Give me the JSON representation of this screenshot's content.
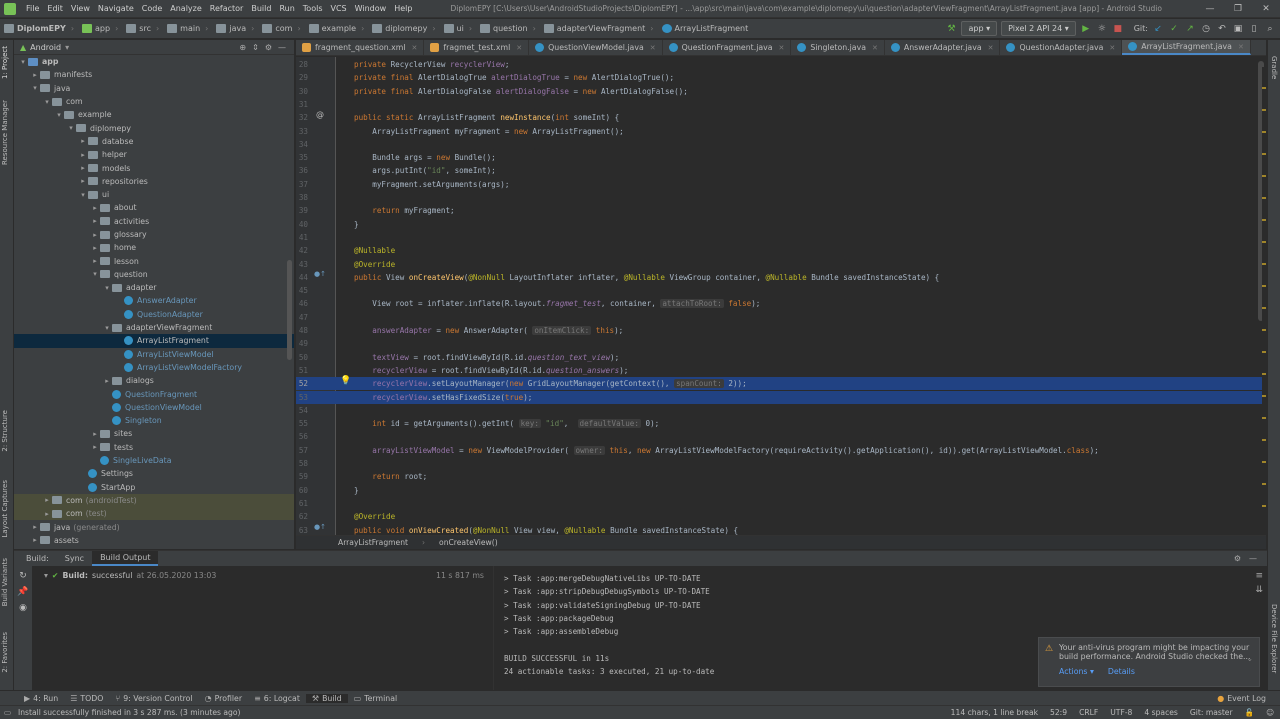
{
  "menu": {
    "items": [
      "File",
      "Edit",
      "View",
      "Navigate",
      "Code",
      "Analyze",
      "Refactor",
      "Build",
      "Run",
      "Tools",
      "VCS",
      "Window",
      "Help"
    ],
    "title": "DiplomEPY [C:\\Users\\User\\AndroidStudioProjects\\DiplomEPY] - ...\\app\\src\\main\\java\\com\\example\\diplomepy\\ui\\question\\adapterViewFragment\\ArrayListFragment.java [app] - Android Studio"
  },
  "breadcrumbs": [
    "DiplomEPY",
    "app",
    "src",
    "main",
    "java",
    "com",
    "example",
    "diplomepy",
    "ui",
    "question",
    "adapterViewFragment",
    "ArrayListFragment"
  ],
  "run_config": {
    "module": "app",
    "device": "Pixel 2 API 24",
    "git_label": "Git:"
  },
  "project": {
    "view": "Android",
    "tree": [
      {
        "label": "app",
        "depth": 0,
        "arrow": "▾",
        "kind": "folder-blue"
      },
      {
        "label": "manifests",
        "depth": 1,
        "arrow": "▸",
        "kind": "folder"
      },
      {
        "label": "java",
        "depth": 1,
        "arrow": "▾",
        "kind": "folder"
      },
      {
        "label": "com",
        "depth": 2,
        "arrow": "▾",
        "kind": "folder"
      },
      {
        "label": "example",
        "depth": 3,
        "arrow": "▾",
        "kind": "folder"
      },
      {
        "label": "diplomepy",
        "depth": 4,
        "arrow": "▾",
        "kind": "folder"
      },
      {
        "label": "databse",
        "depth": 5,
        "arrow": "▸",
        "kind": "folder"
      },
      {
        "label": "helper",
        "depth": 5,
        "arrow": "▸",
        "kind": "folder"
      },
      {
        "label": "models",
        "depth": 5,
        "arrow": "▸",
        "kind": "folder"
      },
      {
        "label": "repositories",
        "depth": 5,
        "arrow": "▸",
        "kind": "folder"
      },
      {
        "label": "ui",
        "depth": 5,
        "arrow": "▾",
        "kind": "folder"
      },
      {
        "label": "about",
        "depth": 6,
        "arrow": "▸",
        "kind": "folder"
      },
      {
        "label": "activities",
        "depth": 6,
        "arrow": "▸",
        "kind": "folder"
      },
      {
        "label": "glossary",
        "depth": 6,
        "arrow": "▸",
        "kind": "folder"
      },
      {
        "label": "home",
        "depth": 6,
        "arrow": "▸",
        "kind": "folder"
      },
      {
        "label": "lesson",
        "depth": 6,
        "arrow": "▸",
        "kind": "folder"
      },
      {
        "label": "question",
        "depth": 6,
        "arrow": "▾",
        "kind": "folder"
      },
      {
        "label": "adapter",
        "depth": 7,
        "arrow": "▾",
        "kind": "folder"
      },
      {
        "label": "AnswerAdapter",
        "depth": 8,
        "arrow": "",
        "kind": "class"
      },
      {
        "label": "QuestionAdapter",
        "depth": 8,
        "arrow": "",
        "kind": "class"
      },
      {
        "label": "adapterViewFragment",
        "depth": 7,
        "arrow": "▾",
        "kind": "folder"
      },
      {
        "label": "ArrayListFragment",
        "depth": 8,
        "arrow": "",
        "kind": "class",
        "selected": true
      },
      {
        "label": "ArrayListViewModel",
        "depth": 8,
        "arrow": "",
        "kind": "class"
      },
      {
        "label": "ArrayListViewModelFactory",
        "depth": 8,
        "arrow": "",
        "kind": "class"
      },
      {
        "label": "dialogs",
        "depth": 7,
        "arrow": "▸",
        "kind": "folder"
      },
      {
        "label": "QuestionFragment",
        "depth": 7,
        "arrow": "",
        "kind": "class"
      },
      {
        "label": "QuestionViewModel",
        "depth": 7,
        "arrow": "",
        "kind": "class"
      },
      {
        "label": "Singleton",
        "depth": 7,
        "arrow": "",
        "kind": "class"
      },
      {
        "label": "sites",
        "depth": 6,
        "arrow": "▸",
        "kind": "folder"
      },
      {
        "label": "tests",
        "depth": 6,
        "arrow": "▸",
        "kind": "folder"
      },
      {
        "label": "SingleLiveData",
        "depth": 6,
        "arrow": "",
        "kind": "class"
      },
      {
        "label": "Settings",
        "depth": 5,
        "arrow": "",
        "kind": "class"
      },
      {
        "label": "StartApp",
        "depth": 5,
        "arrow": "",
        "kind": "class"
      },
      {
        "label": "com",
        "depth": 2,
        "arrow": "▸",
        "kind": "folder",
        "suffix": "(androidTest)",
        "dim": true
      },
      {
        "label": "com",
        "depth": 2,
        "arrow": "▸",
        "kind": "folder",
        "suffix": "(test)",
        "dim": true
      },
      {
        "label": "java",
        "depth": 1,
        "arrow": "▸",
        "kind": "folder",
        "suffix": "(generated)"
      },
      {
        "label": "assets",
        "depth": 1,
        "arrow": "▸",
        "kind": "folder"
      }
    ]
  },
  "left_strip": [
    "1: Project",
    "Resource Manager",
    "2: Structure",
    "Layout Captures",
    "Build Variants",
    "2: Favorites"
  ],
  "right_strip": [
    "Gradle",
    "Device File Explorer"
  ],
  "tabs": [
    {
      "label": "fragment_question.xml",
      "color": "#e0a044"
    },
    {
      "label": "fragmet_test.xml",
      "color": "#e0a044"
    },
    {
      "label": "QuestionViewModel.java",
      "color": "#3592c4"
    },
    {
      "label": "QuestionFragment.java",
      "color": "#3592c4"
    },
    {
      "label": "Singleton.java",
      "color": "#3592c4"
    },
    {
      "label": "AnswerAdapter.java",
      "color": "#3592c4"
    },
    {
      "label": "QuestionAdapter.java",
      "color": "#3592c4"
    },
    {
      "label": "ArrayListFragment.java",
      "color": "#3592c4",
      "active": true
    }
  ],
  "code_lines": [
    {
      "n": "28",
      "html": "<span class=\"kw\">private </span>RecyclerView <span class=\"fld\">recyclerView</span>;"
    },
    {
      "n": "29",
      "html": "<span class=\"kw\">private final </span>AlertDialogTrue <span class=\"fld\">alertDialogTrue </span>= <span class=\"kw\">new </span>AlertDialogTrue();"
    },
    {
      "n": "30",
      "html": "<span class=\"kw\">private final </span>AlertDialogFalse <span class=\"fld\">alertDialogFalse </span>= <span class=\"kw\">new </span>AlertDialogFalse();"
    },
    {
      "n": "31",
      "html": ""
    },
    {
      "n": "32",
      "html": "<span class=\"kw\">public static </span>ArrayListFragment <span class=\"fn\">newInstance</span>(<span class=\"kw\">int </span>someInt) {"
    },
    {
      "n": "33",
      "html": "    ArrayListFragment myFragment = <span class=\"kw\">new </span>ArrayListFragment();"
    },
    {
      "n": "34",
      "html": ""
    },
    {
      "n": "35",
      "html": "    Bundle args = <span class=\"kw\">new </span>Bundle();"
    },
    {
      "n": "36",
      "html": "    args.putInt(<span class=\"str\">\"id\"</span>, someInt);"
    },
    {
      "n": "37",
      "html": "    myFragment.setArguments(args);"
    },
    {
      "n": "38",
      "html": ""
    },
    {
      "n": "39",
      "html": "    <span class=\"kw\">return </span>myFragment;"
    },
    {
      "n": "40",
      "html": "}"
    },
    {
      "n": "41",
      "html": ""
    },
    {
      "n": "42",
      "html": "<span class=\"an\">@Nullable</span>"
    },
    {
      "n": "43",
      "html": "<span class=\"an\">@Override</span>"
    },
    {
      "n": "44",
      "html": "<span class=\"kw\">public </span>View <span class=\"fn\">onCreateView</span>(<span class=\"an\">@NonNull </span>LayoutInflater inflater, <span class=\"an\">@Nullable </span>ViewGroup container, <span class=\"an\">@Nullable </span>Bundle savedInstanceState) {"
    },
    {
      "n": "45",
      "html": ""
    },
    {
      "n": "46",
      "html": "    View root = inflater.inflate(R.layout.<span class=\"fld it\">fragmet_test</span>, container, <span class=\"hint\">attachToRoot:</span> <span class=\"kw\">false</span>);"
    },
    {
      "n": "47",
      "html": ""
    },
    {
      "n": "48",
      "html": "    <span class=\"fld\">answerAdapter </span>= <span class=\"kw\">new </span>AnswerAdapter( <span class=\"hint\">onItemClick:</span> <span class=\"kw\">this</span>);"
    },
    {
      "n": "49",
      "html": ""
    },
    {
      "n": "50",
      "html": "    <span class=\"fld\">textView </span>= root.findViewById(R.id.<span class=\"fld it\">question_text_view</span>);"
    },
    {
      "n": "51",
      "html": "    <span class=\"fld\">recyclerView </span>= root.findViewById(R.id.<span class=\"fld it\">question_answers</span>);"
    },
    {
      "n": "52",
      "html": "    <span class=\"fld\">recyclerView</span>.setLayoutManager(<span class=\"kw\">new </span>GridLayoutManager(getContext(), <span class=\"hint\">spanCount:</span> 2));",
      "hl": true
    },
    {
      "n": "53",
      "html": "    <span class=\"fld\">recyclerView</span>.setHasFixedSize(<span class=\"kw\">true</span>);",
      "hl": true
    },
    {
      "n": "54",
      "html": ""
    },
    {
      "n": "55",
      "html": "    <span class=\"kw\">int </span>id = getArguments().getInt( <span class=\"hint\">key:</span> <span class=\"str\">\"id\"</span>,  <span class=\"hint\">defaultValue:</span> 0);"
    },
    {
      "n": "56",
      "html": ""
    },
    {
      "n": "57",
      "html": "    <span class=\"fld\">arrayListViewModel </span>= <span class=\"kw\">new </span>ViewModelProvider( <span class=\"hint\">owner:</span> <span class=\"kw\">this</span>, <span class=\"kw\">new </span>ArrayListViewModelFactory(requireActivity().getApplication(), id)).get(ArrayListViewModel.<span class=\"kw\">class</span>);"
    },
    {
      "n": "58",
      "html": ""
    },
    {
      "n": "59",
      "html": "    <span class=\"kw\">return </span>root;"
    },
    {
      "n": "60",
      "html": "}"
    },
    {
      "n": "61",
      "html": ""
    },
    {
      "n": "62",
      "html": "<span class=\"an\">@Override</span>"
    },
    {
      "n": "63",
      "html": "<span class=\"kw\">public void </span><span class=\"fn\">onViewCreated</span>(<span class=\"an\">@NonNull </span>View view, <span class=\"an\">@Nullable </span>Bundle savedInstanceState) {"
    }
  ],
  "editor_breadcrumb": [
    "ArrayListFragment",
    "onCreateView()"
  ],
  "build": {
    "tabs": [
      "Build:",
      "Sync",
      "Build Output"
    ],
    "status_prefix": "Build:",
    "status": "successful",
    "timestamp": "at 26.05.2020 13:03",
    "duration": "11 s 817 ms",
    "output": [
      "> Task :app:mergeDebugNativeLibs UP-TO-DATE",
      "> Task :app:stripDebugDebugSymbols UP-TO-DATE",
      "> Task :app:validateSigningDebug UP-TO-DATE",
      "> Task :app:packageDebug",
      "> Task :app:assembleDebug",
      "",
      "BUILD SUCCESSFUL in 11s",
      "24 actionable tasks: 3 executed, 21 up-to-date"
    ]
  },
  "notification": {
    "text1": "Your anti-virus program might be impacting your",
    "text2": "build performance. Android Studio checked the...",
    "action": "Actions ▾",
    "details": "Details"
  },
  "toolwindows": [
    {
      "label": "4: Run",
      "icon": "▶"
    },
    {
      "label": "TODO",
      "icon": "☰"
    },
    {
      "label": "9: Version Control",
      "icon": "⑂"
    },
    {
      "label": "Profiler",
      "icon": "◔"
    },
    {
      "label": "6: Logcat",
      "icon": "≡"
    },
    {
      "label": "Build",
      "icon": "⚒",
      "active": true
    },
    {
      "label": "Terminal",
      "icon": "▭"
    }
  ],
  "event_log": "Event Log",
  "statusbar": {
    "message": "Install successfully finished in 3 s 287 ms. (3 minutes ago)",
    "chars": "114 chars, 1 line break",
    "position": "52:9",
    "eol": "CRLF",
    "encoding": "UTF-8",
    "indent": "4 spaces",
    "branch": "Git: master"
  }
}
